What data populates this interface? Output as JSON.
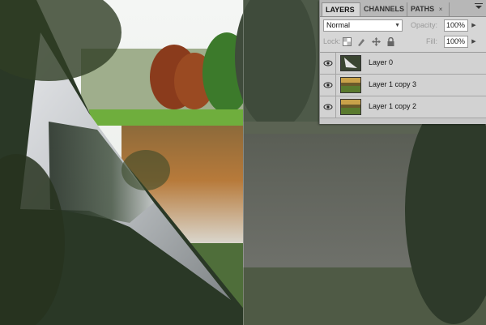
{
  "panel": {
    "tabs": [
      {
        "label": "LAYERS",
        "active": true
      },
      {
        "label": "CHANNELS",
        "active": false
      },
      {
        "label": "PATHS",
        "active": false
      }
    ],
    "tab_close": "×",
    "menu_icon": "panel-menu-icon",
    "blend_mode": "Normal",
    "opacity_label": "Opacity:",
    "opacity_value": "100%",
    "lock_label": "Lock:",
    "fill_label": "Fill:",
    "fill_value": "100%",
    "lock_icons": [
      "lock-transparent-icon",
      "lock-paint-icon",
      "lock-move-icon",
      "lock-all-icon"
    ],
    "layers": [
      {
        "name": "Layer 0",
        "visible": true
      },
      {
        "name": "Layer 1 copy 3",
        "visible": true
      },
      {
        "name": "Layer 1 copy 2",
        "visible": true
      }
    ]
  },
  "colors": {
    "panel_bg": "#d6d6d6",
    "tab_bar": "#b7b7b7"
  }
}
